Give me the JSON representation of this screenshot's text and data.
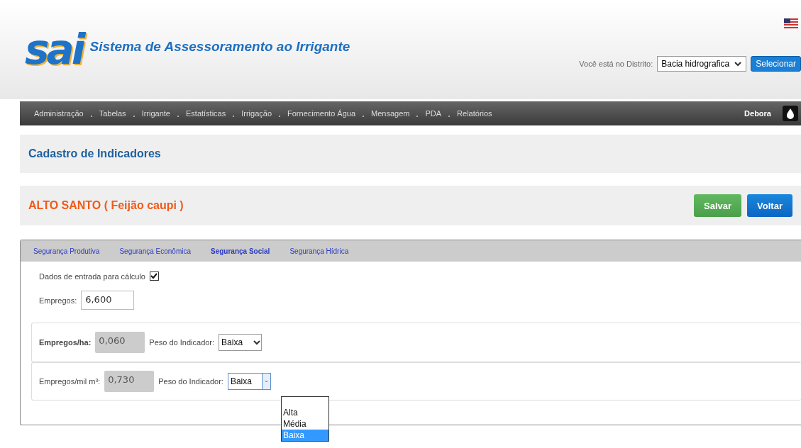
{
  "header": {
    "logo_text": "sai",
    "title": "Sistema de Assessoramento ao Irrigante",
    "district_label": "Você está no Distrito:",
    "district_value": "Bacia hidrografica",
    "select_button": "Selecionar"
  },
  "nav": {
    "items": [
      "Administração",
      "Tabelas",
      "Irrigante",
      "Estatísticas",
      "Irrigação",
      "Fornecimento Água",
      "Mensagem",
      "PDA",
      "Relatórios"
    ],
    "user": "Debora"
  },
  "page_title": "Cadastro de Indicadores",
  "record": {
    "title": "ALTO SANTO ( Feijão caupi )",
    "buttons": [
      {
        "label": "Salvar",
        "kind": "success"
      },
      {
        "label": "Voltar",
        "kind": "primary"
      }
    ]
  },
  "tabs": [
    {
      "label": "Segurança Produtiva",
      "selected": false
    },
    {
      "label": "Segurança Econômica",
      "selected": false
    },
    {
      "label": "Segurança Social",
      "selected": true
    },
    {
      "label": "Segurança Hídrica",
      "selected": false
    }
  ],
  "input_section": {
    "checkbox_label": "Dados de entrada para cálculo",
    "checked": true,
    "field_label": "Empregos:",
    "field_value": "6,600"
  },
  "indicators": [
    {
      "label": "Empregos/ha:",
      "bold": true,
      "value": "0,060",
      "weight_label": "Peso do Indicador:",
      "weight": "Baixa",
      "open": false
    },
    {
      "label": "Empregos/mil m³:",
      "bold": false,
      "value": "0,730",
      "weight_label": "Peso do Indicador:",
      "weight": "Baixa",
      "open": true
    }
  ],
  "dropdown_options": [
    {
      "label": "Alta",
      "selected": false
    },
    {
      "label": "Média",
      "selected": false
    },
    {
      "label": "Baixa",
      "selected": true
    }
  ]
}
